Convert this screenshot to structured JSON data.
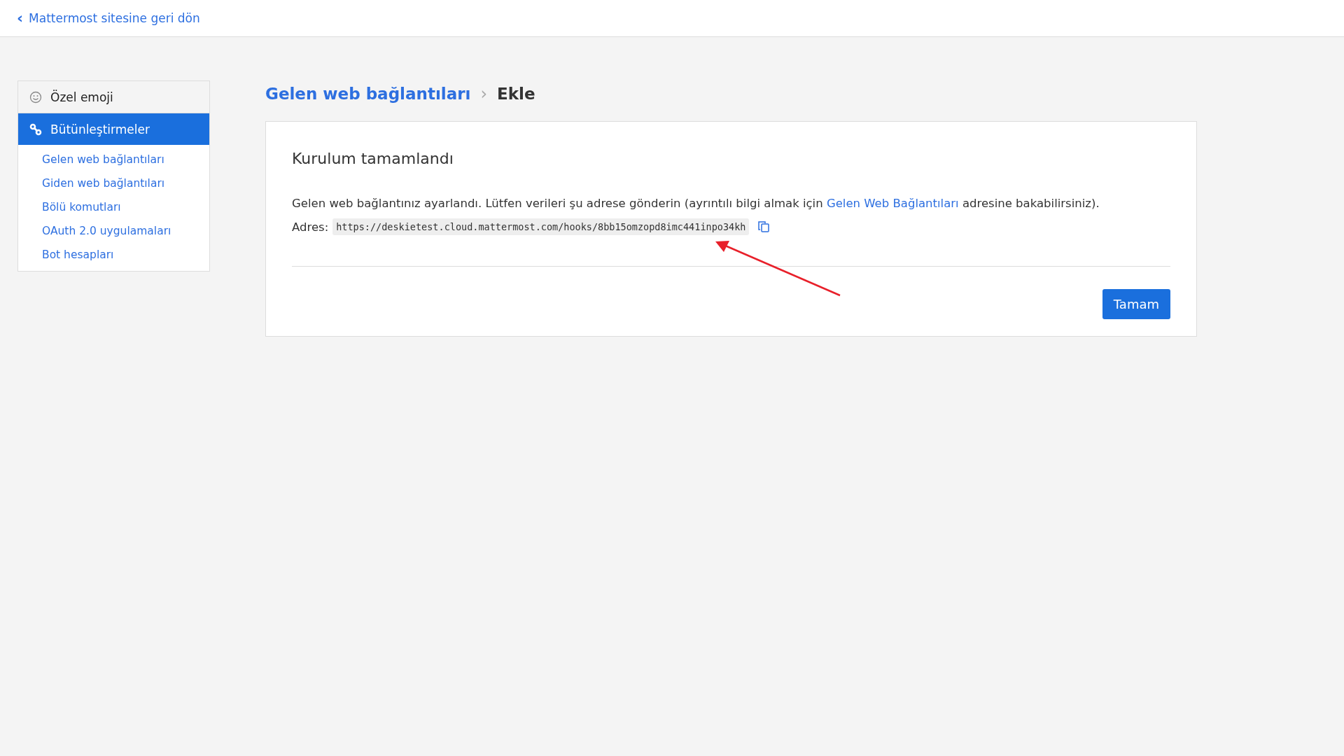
{
  "back_link": {
    "icon": "‹",
    "label": "Mattermost sitesine geri dön"
  },
  "sidebar": {
    "items": [
      {
        "kind": "emoji",
        "label": "Özel emoji",
        "selected": false
      },
      {
        "kind": "link",
        "label": "Bütünleştirmeler",
        "selected": true
      }
    ],
    "subitems": [
      {
        "label": "Gelen web bağlantıları",
        "selected": false
      },
      {
        "label": "Giden web bağlantıları",
        "selected": false
      },
      {
        "label": "Bölü komutları",
        "selected": false
      },
      {
        "label": "OAuth 2.0 uygulamaları",
        "selected": false
      },
      {
        "label": "Bot hesapları",
        "selected": false
      }
    ]
  },
  "breadcrumb": {
    "parent": "Gelen web bağlantıları",
    "separator": "›",
    "current": "Ekle"
  },
  "card": {
    "title": "Kurulum tamamlandı",
    "message_before": "Gelen web bağlantınız ayarlandı. Lütfen verileri şu adrese gönderin (ayrıntılı bilgi almak için ",
    "message_link": "Gelen Web Bağlantıları",
    "message_after": " adresine bakabilirsiniz).",
    "address_label": "Adres:",
    "address": "https://deskietest.cloud.mattermost.com/hooks/8bb15omzopd8imc441inpo34kh",
    "button": "Tamam"
  }
}
